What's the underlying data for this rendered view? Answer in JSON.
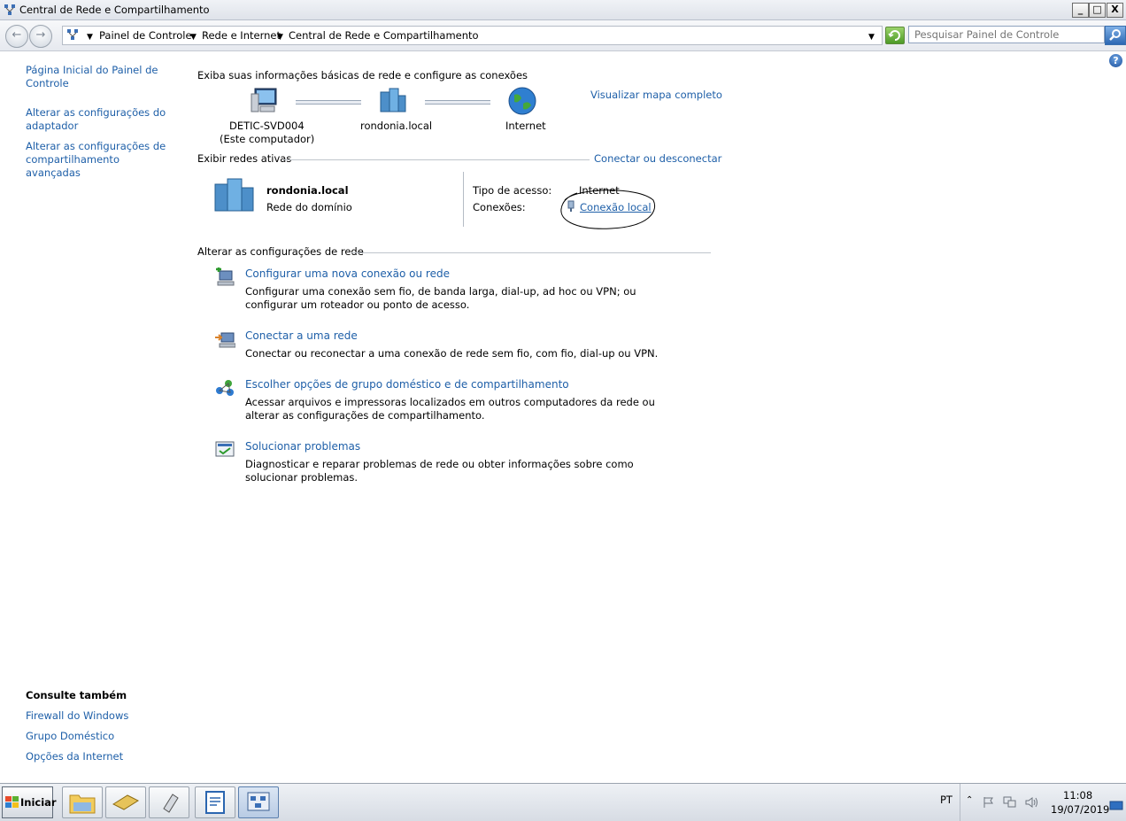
{
  "window": {
    "title": "Central de Rede e Compartilhamento",
    "controls": {
      "minimize": "_",
      "maximize": "□",
      "close": "X"
    }
  },
  "address_bar": {
    "back_icon": "back-arrow-icon",
    "forward_icon": "forward-arrow-icon",
    "breadcrumbs": [
      "Painel de Controle",
      "Rede e Internet",
      "Central de Rede e Compartilhamento"
    ],
    "search_placeholder": "Pesquisar Painel de Controle"
  },
  "left_pane": {
    "links": [
      "Página Inicial do Painel de Controle",
      "Alterar as configurações do adaptador",
      "Alterar as configurações de compartilhamento avançadas"
    ],
    "see_also_title": "Consulte também",
    "see_also": [
      "Firewall do Windows",
      "Grupo Doméstico",
      "Opções da Internet"
    ]
  },
  "main": {
    "heading": "Exiba suas informações básicas de rede e configure as conexões",
    "view_full_map": "Visualizar mapa completo",
    "map": {
      "computer_name": "DETIC-SVD004",
      "computer_sub": "(Este computador)",
      "domain": "rondonia.local",
      "internet": "Internet"
    },
    "active_networks_title": "Exibir redes ativas",
    "connect_disconnect": "Conectar ou desconectar",
    "active_network": {
      "name": "rondonia.local",
      "type": "Rede do domínio",
      "access_type_label": "Tipo de acesso:",
      "access_type_value": "Internet",
      "connections_label": "Conexões:",
      "connection_link": "Conexão local"
    },
    "change_settings_title": "Alterar as configurações de rede",
    "tasks": [
      {
        "title": "Configurar uma nova conexão ou rede",
        "desc": "Configurar uma conexão sem fio, de banda larga, dial-up, ad hoc ou VPN; ou configurar um roteador ou ponto de acesso."
      },
      {
        "title": "Conectar a uma rede",
        "desc": "Conectar ou reconectar a uma conexão de rede sem fio, com fio, dial-up ou VPN."
      },
      {
        "title": "Escolher opções de grupo doméstico e de compartilhamento",
        "desc": "Acessar arquivos e impressoras localizados em outros computadores da rede ou alterar as configurações de compartilhamento."
      },
      {
        "title": "Solucionar problemas",
        "desc": "Diagnosticar e reparar problemas de rede ou obter informações sobre como solucionar problemas."
      }
    ]
  },
  "taskbar": {
    "start_label": "Iniciar",
    "language": "PT",
    "time": "11:08",
    "date": "19/07/2019"
  }
}
